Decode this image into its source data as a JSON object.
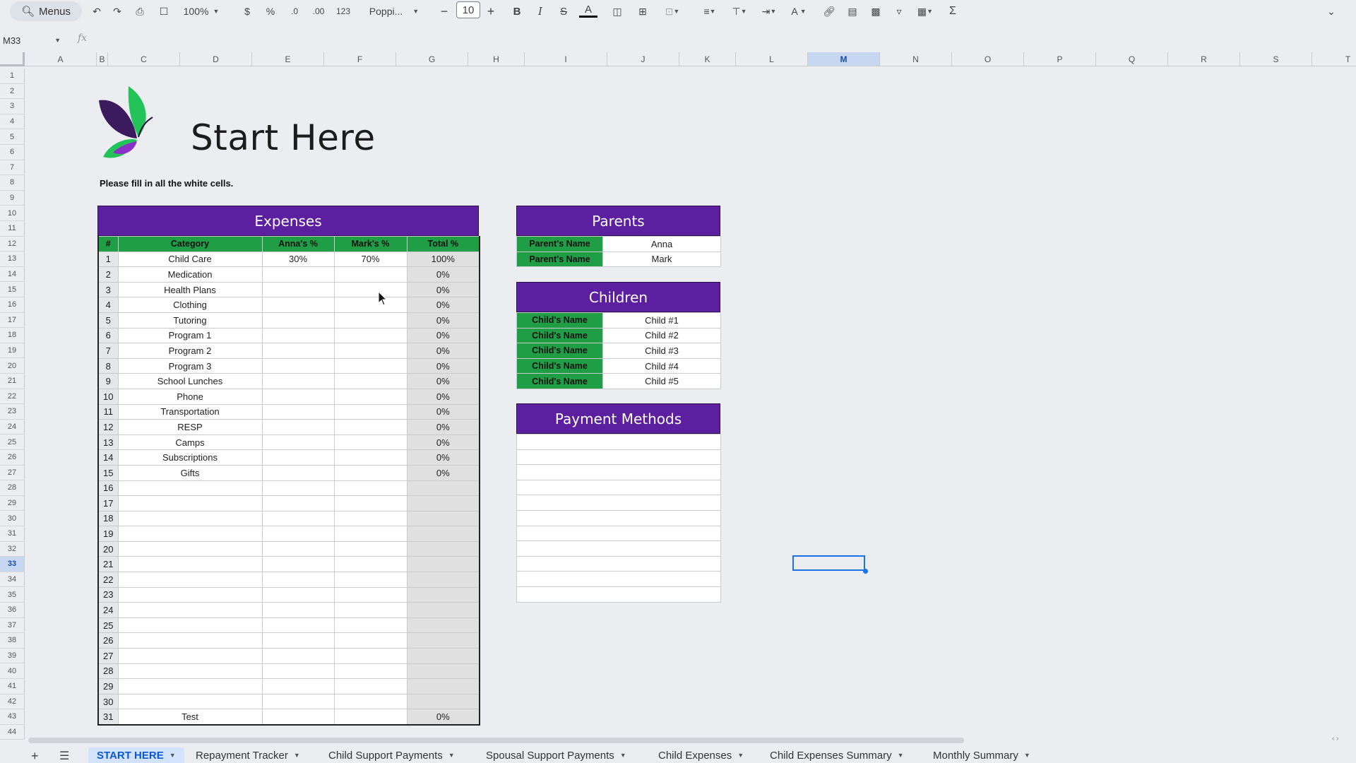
{
  "toolbar": {
    "menus_label": "Menus",
    "zoom": "100%",
    "currency": "$",
    "percent": "%",
    "dec_decrease": ".0",
    "dec_increase": ".00",
    "number_format": "123",
    "font": "Poppi...",
    "font_size": "10",
    "minus": "−",
    "plus": "+",
    "bold": "B",
    "italic": "I",
    "strike": "S",
    "text_color": "A",
    "text_rotate": "A",
    "sum": "Σ"
  },
  "formula_bar": {
    "cell_ref": "M33",
    "fx": "fx"
  },
  "columns": [
    "A",
    "B",
    "C",
    "D",
    "E",
    "F",
    "G",
    "H",
    "I",
    "J",
    "K",
    "L",
    "M",
    "N",
    "O",
    "P",
    "Q",
    "R",
    "S",
    "T"
  ],
  "selected_column": "M",
  "rows": [
    "1",
    "2",
    "3",
    "4",
    "5",
    "6",
    "7",
    "8",
    "9",
    "10",
    "11",
    "12",
    "13",
    "14",
    "15",
    "16",
    "17",
    "18",
    "19",
    "20",
    "21",
    "22",
    "23",
    "24",
    "25",
    "26",
    "27",
    "28",
    "29",
    "30",
    "31",
    "32",
    "33",
    "34",
    "35",
    "36",
    "37",
    "38",
    "39",
    "40",
    "41",
    "42",
    "43",
    "44"
  ],
  "selected_row": "33",
  "page": {
    "title": "Start Here",
    "subtitle": "Please fill in all the white cells."
  },
  "expenses": {
    "title": "Expenses",
    "headers": [
      "#",
      "Category",
      "Anna's %",
      "Mark's %",
      "Total %"
    ],
    "rows": [
      [
        "1",
        "Child Care",
        "30%",
        "70%",
        "100%"
      ],
      [
        "2",
        "Medication",
        "",
        "",
        "0%"
      ],
      [
        "3",
        "Health Plans",
        "",
        "",
        "0%"
      ],
      [
        "4",
        "Clothing",
        "",
        "",
        "0%"
      ],
      [
        "5",
        "Tutoring",
        "",
        "",
        "0%"
      ],
      [
        "6",
        "Program 1",
        "",
        "",
        "0%"
      ],
      [
        "7",
        "Program 2",
        "",
        "",
        "0%"
      ],
      [
        "8",
        "Program 3",
        "",
        "",
        "0%"
      ],
      [
        "9",
        "School Lunches",
        "",
        "",
        "0%"
      ],
      [
        "10",
        "Phone",
        "",
        "",
        "0%"
      ],
      [
        "11",
        "Transportation",
        "",
        "",
        "0%"
      ],
      [
        "12",
        "RESP",
        "",
        "",
        "0%"
      ],
      [
        "13",
        "Camps",
        "",
        "",
        "0%"
      ],
      [
        "14",
        "Subscriptions",
        "",
        "",
        "0%"
      ],
      [
        "15",
        "Gifts",
        "",
        "",
        "0%"
      ],
      [
        "16",
        "",
        "",
        "",
        ""
      ],
      [
        "17",
        "",
        "",
        "",
        ""
      ],
      [
        "18",
        "",
        "",
        "",
        ""
      ],
      [
        "19",
        "",
        "",
        "",
        ""
      ],
      [
        "20",
        "",
        "",
        "",
        ""
      ],
      [
        "21",
        "",
        "",
        "",
        ""
      ],
      [
        "22",
        "",
        "",
        "",
        ""
      ],
      [
        "23",
        "",
        "",
        "",
        ""
      ],
      [
        "24",
        "",
        "",
        "",
        ""
      ],
      [
        "25",
        "",
        "",
        "",
        ""
      ],
      [
        "26",
        "",
        "",
        "",
        ""
      ],
      [
        "27",
        "",
        "",
        "",
        ""
      ],
      [
        "28",
        "",
        "",
        "",
        ""
      ],
      [
        "29",
        "",
        "",
        "",
        ""
      ],
      [
        "30",
        "",
        "",
        "",
        ""
      ],
      [
        "31",
        "Test",
        "",
        "",
        "0%"
      ]
    ]
  },
  "parents": {
    "title": "Parents",
    "rows": [
      {
        "label": "Parent's Name",
        "value": "Anna"
      },
      {
        "label": "Parent's Name",
        "value": "Mark"
      }
    ]
  },
  "children": {
    "title": "Children",
    "rows": [
      {
        "label": "Child's Name",
        "value": "Child #1"
      },
      {
        "label": "Child's Name",
        "value": "Child #2"
      },
      {
        "label": "Child's Name",
        "value": "Child #3"
      },
      {
        "label": "Child's Name",
        "value": "Child #4"
      },
      {
        "label": "Child's Name",
        "value": "Child #5"
      }
    ]
  },
  "payment_methods": {
    "title": "Payment Methods",
    "rows": 11
  },
  "sheets": [
    {
      "name": "START HERE",
      "active": true
    },
    {
      "name": "Repayment Tracker",
      "active": false
    },
    {
      "name": "Child Support Payments",
      "active": false
    },
    {
      "name": "Spousal Support Payments",
      "active": false
    },
    {
      "name": "Child Expenses",
      "active": false
    },
    {
      "name": "Child Expenses Summary",
      "active": false
    },
    {
      "name": "Monthly Summary",
      "active": false
    }
  ],
  "colors": {
    "band_purple": "#5b1fa0",
    "header_green": "#1f9e45",
    "selection_blue": "#1a73e8"
  }
}
